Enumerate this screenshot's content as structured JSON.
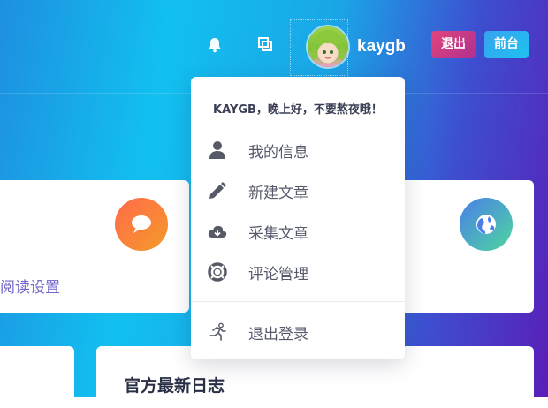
{
  "header": {
    "username": "kaygb",
    "exit_button_label": "退出",
    "front_button_label": "前台"
  },
  "cards": {
    "reading_settings_link": "阅读设置",
    "news_title": "官方最新日志"
  },
  "dropdown": {
    "greeting": "KAYGB，晚上好，不要熬夜哦！",
    "items": [
      {
        "label": "我的信息",
        "icon": "user-icon"
      },
      {
        "label": "新建文章",
        "icon": "pencil-icon"
      },
      {
        "label": "采集文章",
        "icon": "cloud-download-icon"
      },
      {
        "label": "评论管理",
        "icon": "lifebuoy-icon"
      }
    ],
    "logout_label": "退出登录",
    "logout_icon": "running-icon"
  },
  "colors": {
    "exit_button": "#c9367f",
    "front_button": "#2bb3f0",
    "chat_circle": "#f07a3a",
    "globe_circle": "#4f8ee0"
  }
}
